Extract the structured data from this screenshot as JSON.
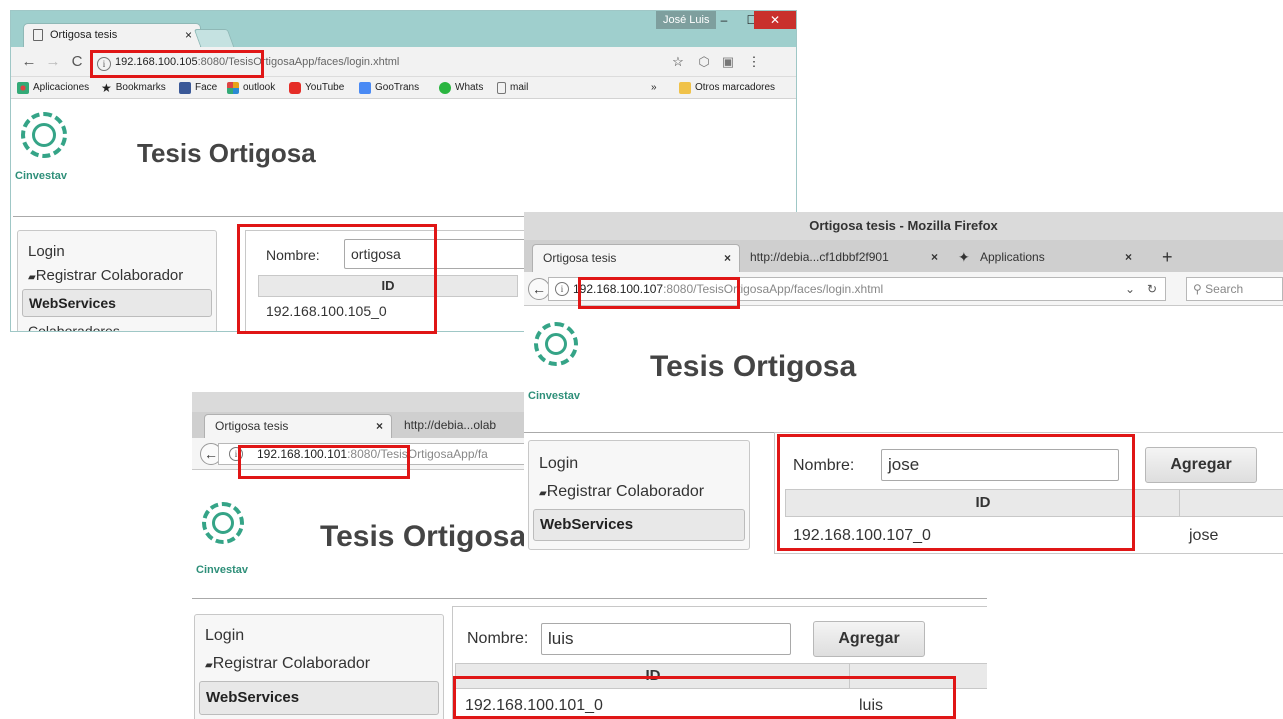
{
  "window1": {
    "tab_title": "Ortigosa tesis",
    "tab_close": "×",
    "user": "José Luis",
    "url_host": "192.168.100.105",
    "url_rest": ":8080/TesisOrtigosaApp/faces/login.xhtml",
    "bookmarks": [
      {
        "label": "Aplicaciones",
        "icon": "apps-grid-icon",
        "color": "#d44"
      },
      {
        "label": "Bookmarks",
        "icon": "star-icon",
        "color": "#333"
      },
      {
        "label": "Face",
        "icon": "facebook-icon",
        "color": "#3b5998"
      },
      {
        "label": "outlook",
        "icon": "outlook-icon",
        "color": "#e8a317"
      },
      {
        "label": "YouTube",
        "icon": "youtube-icon",
        "color": "#e52d27"
      },
      {
        "label": "GooTrans",
        "icon": "google-translate-icon",
        "color": "#4a8af4"
      },
      {
        "label": "Whats",
        "icon": "whatsapp-icon",
        "color": "#2ab540"
      },
      {
        "label": "mail",
        "icon": "document-icon",
        "color": "#777"
      }
    ],
    "bookmarks_more": "»",
    "other_bookmarks": "Otros marcadores",
    "page": {
      "logo_text": "Cinvestav",
      "app_title": "Tesis Ortigosa",
      "menu": {
        "login": "Login",
        "register": "Registrar Colaborador",
        "webservices": "WebServices",
        "colaboradores": "Colaboradores"
      },
      "name_label": "Nombre:",
      "name_value": "ortigosa",
      "col_id": "ID",
      "row_id": "192.168.100.105_0"
    }
  },
  "window2": {
    "title": "Ortigosa tesis - Mozilla Firefox",
    "tabs": [
      {
        "label": "Ortigosa tesis",
        "close": "×"
      },
      {
        "label": "http://debia...cf1dbbf2f901",
        "close": "×"
      },
      {
        "label": "Applications",
        "close": "×"
      }
    ],
    "new_tab": "+",
    "url_host": "192.168.100.107",
    "url_rest": ":8080/TesisOrtigosaApp/faces/login.xhtml",
    "search_placeholder": "Search",
    "page": {
      "logo_text": "Cinvestav",
      "app_title": "Tesis Ortigosa",
      "menu": {
        "login": "Login",
        "register": "Registrar Colaborador",
        "webservices": "WebServices"
      },
      "name_label": "Nombre:",
      "name_value": "jose",
      "add_button": "Agregar",
      "col_id": "ID",
      "row_id": "192.168.100.107_0",
      "row_name": "jose"
    }
  },
  "window3": {
    "tabs": [
      {
        "label": "Ortigosa tesis",
        "close": "×"
      },
      {
        "label": "http://debia...olab"
      }
    ],
    "url_host": "192.168.100.101",
    "url_rest": ":8080/TesisOrtigosaApp/fa",
    "page": {
      "logo_text": "Cinvestav",
      "app_title": "Tesis Ortigosa",
      "menu": {
        "login": "Login",
        "register": "Registrar Colaborador",
        "webservices": "WebServices"
      },
      "name_label": "Nombre:",
      "name_value": "luis",
      "add_button": "Agregar",
      "col_id": "ID",
      "row_id": "192.168.100.101_0",
      "row_name": "luis"
    }
  },
  "colors": {
    "highlight": "#e01616",
    "logo": "#35a487",
    "chrome_frame": "#9fcfcd"
  }
}
